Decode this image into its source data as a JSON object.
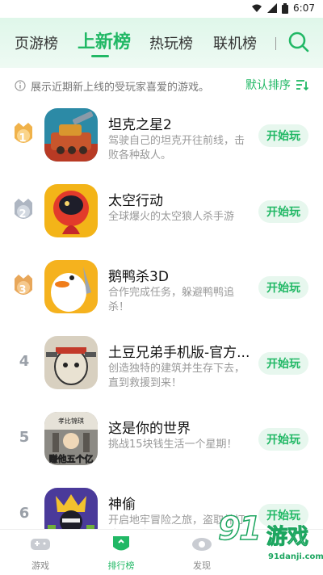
{
  "status_bar": {
    "time": "6:07"
  },
  "tabs": [
    {
      "label": "页游榜",
      "active": false
    },
    {
      "label": "上新榜",
      "active": true
    },
    {
      "label": "热玩榜",
      "active": false
    },
    {
      "label": "联机榜",
      "active": false
    }
  ],
  "notice": {
    "text": "展示近期新上线的受玩家喜爱的游戏。",
    "sort_label": "默认排序"
  },
  "games": [
    {
      "rank": "1",
      "title": "坦克之星2",
      "desc": "驾驶自己的坦克开往前线，击败各种敌人。",
      "action": "开始玩"
    },
    {
      "rank": "2",
      "title": "太空行动",
      "desc": "全球爆火的太空狼人杀手游",
      "action": "开始玩"
    },
    {
      "rank": "3",
      "title": "鹅鸭杀3D",
      "desc": "合作完成任务，躲避鸭鸭追杀！",
      "action": "开始玩"
    },
    {
      "rank": "4",
      "title": "土豆兄弟手机版-官方...",
      "desc": "创造独特的建筑并生存下去，直到救援到来！",
      "action": "开始玩"
    },
    {
      "rank": "5",
      "title": "这是你的世界",
      "desc": "挑战15块钱生活一个星期！",
      "action": "开始玩"
    },
    {
      "rank": "6",
      "title": "神偷",
      "desc": "开启地牢冒险之旅，盗取并打造专属宝石",
      "action": "开始玩"
    }
  ],
  "game_icon_texts": {
    "g5_top": "孝比锦琪",
    "g5_bottom": "赚他五个亿"
  },
  "bottom_nav": [
    {
      "label": "游戏",
      "active": false,
      "icon": "gamepad-icon"
    },
    {
      "label": "排行榜",
      "active": true,
      "icon": "leaderboard-icon"
    },
    {
      "label": "发现",
      "active": false,
      "icon": "discover-icon"
    }
  ],
  "watermark": {
    "big": "91",
    "cn": "游戏",
    "url": "91danji.com"
  },
  "colors": {
    "accent": "#21b865",
    "gold": "#f0b24a",
    "silver": "#aeb6c2",
    "bronze": "#e8a75a"
  }
}
